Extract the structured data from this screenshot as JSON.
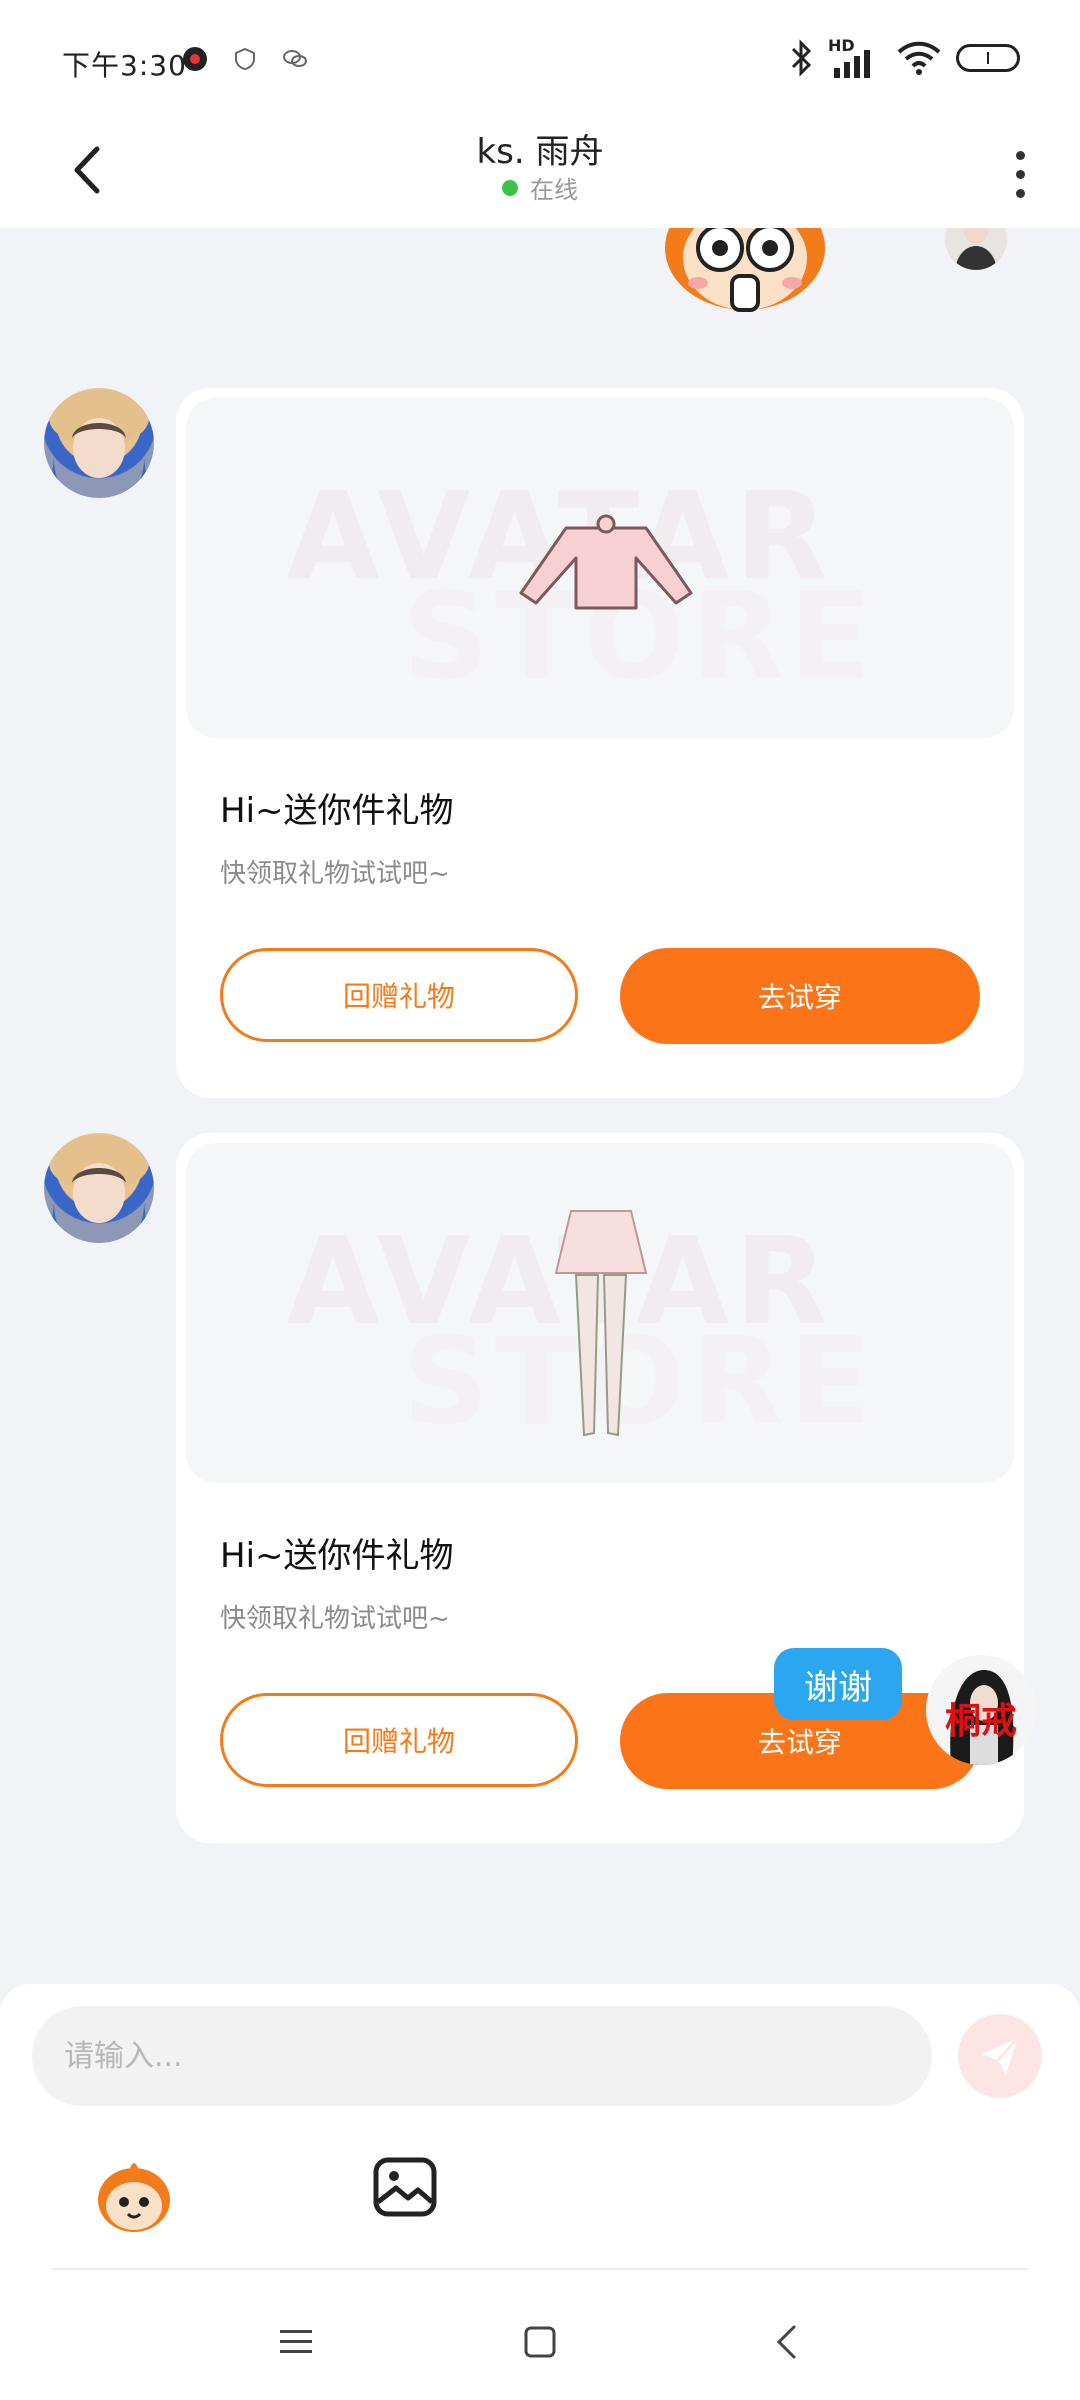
{
  "status_bar": {
    "time": "下午3:30",
    "network_label": "HD"
  },
  "header": {
    "title": "ks. 雨舟",
    "status": "在线"
  },
  "messages": [
    {
      "title": "Hi~送你件礼物",
      "subtitle": "快领取礼物试试吧~",
      "watermark_line1": "AVATAR",
      "watermark_line2": "STORE",
      "return_gift_label": "回赠礼物",
      "try_on_label": "去试穿"
    },
    {
      "title": "Hi~送你件礼物",
      "subtitle": "快领取礼物试试吧~",
      "watermark_line1": "AVATAR",
      "watermark_line2": "STORE",
      "return_gift_label": "回赠礼物",
      "try_on_label": "去试穿"
    }
  ],
  "my_message": "谢谢",
  "my_avatar_text": "桐戒",
  "composer": {
    "placeholder": "请输入..."
  },
  "colors": {
    "accent": "#fb7418",
    "bubble_blue": "#2aa7f0",
    "online": "#3cc24a"
  }
}
